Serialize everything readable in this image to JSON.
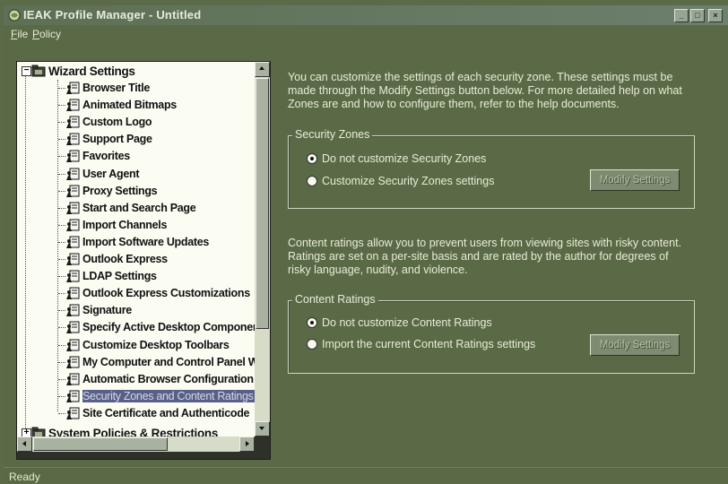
{
  "window": {
    "title": "IEAK Profile Manager - Untitled",
    "controls": {
      "minimize": "_",
      "maximize": "□",
      "close": "×"
    }
  },
  "menu": {
    "file": {
      "mnemonic": "F",
      "rest": "ile"
    },
    "policy": {
      "mnemonic": "P",
      "rest": "olicy"
    }
  },
  "tree": {
    "root_label": "Wizard Settings",
    "root_expander": "−",
    "items": [
      {
        "label": "Browser Title"
      },
      {
        "label": "Animated Bitmaps"
      },
      {
        "label": "Custom Logo"
      },
      {
        "label": "Support Page"
      },
      {
        "label": "Favorites"
      },
      {
        "label": "User Agent"
      },
      {
        "label": "Proxy Settings"
      },
      {
        "label": "Start and Search Page"
      },
      {
        "label": "Import Channels"
      },
      {
        "label": "Import Software Updates"
      },
      {
        "label": "Outlook Express"
      },
      {
        "label": "LDAP Settings"
      },
      {
        "label": "Outlook Express Customizations"
      },
      {
        "label": "Signature"
      },
      {
        "label": "Specify Active Desktop Components"
      },
      {
        "label": "Customize Desktop Toolbars"
      },
      {
        "label": "My Computer and Control Panel Webview"
      },
      {
        "label": "Automatic Browser Configuration"
      },
      {
        "label": "Security Zones and Content Ratings"
      },
      {
        "label": "Site Certificate and Authenticode"
      }
    ],
    "selected_item": "Security Zones and Content Ratings",
    "second_root_label": "System Policies & Restrictions",
    "second_root_expander": "+"
  },
  "security": {
    "description": [
      "You can customize the settings of each security zone. These settings must be",
      "made through the Modify Settings button below. For more detailed help on what",
      "Zones are and how to configure them, refer to the help documents."
    ],
    "group_label": "Security Zones",
    "options": [
      {
        "label": "Do not customize Security Zones",
        "checked": true
      },
      {
        "label": "Customize Security Zones settings",
        "checked": false
      }
    ],
    "button_label": "Modify Settings"
  },
  "ratings": {
    "description": [
      "Content ratings allow you to prevent users from viewing sites with risky content.",
      "Ratings are set on a per-site basis and are rated by the author for degrees of",
      "risky language, nudity, and violence."
    ],
    "group_label": "Content Ratings",
    "options": [
      {
        "label": "Do not customize Content Ratings",
        "checked": true
      },
      {
        "label": "Import the current Content Ratings settings",
        "checked": false
      }
    ],
    "button_label": "Modify Settings"
  },
  "status": {
    "text": "Ready"
  }
}
